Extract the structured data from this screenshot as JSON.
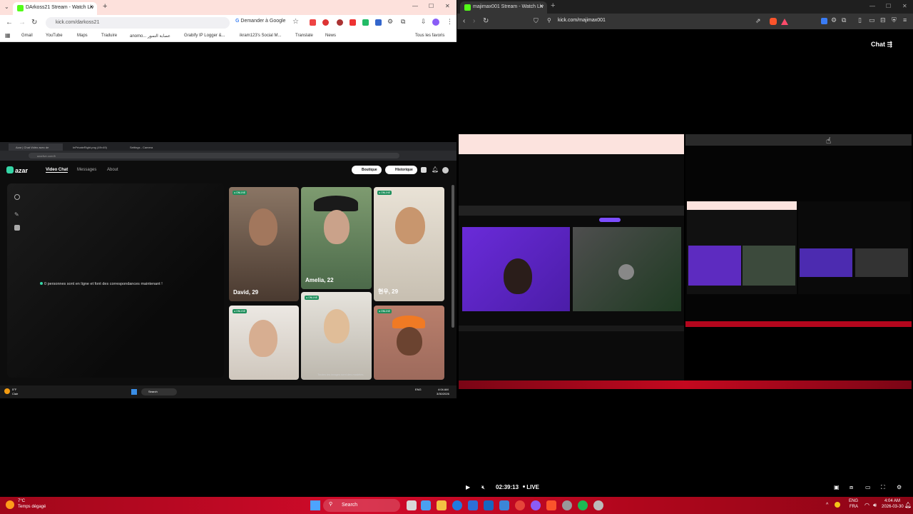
{
  "left_browser": {
    "tab_title": "DArkoss21 Stream - Watch Liv",
    "url": "kick.com/darkoss21",
    "ask_google": "Demander à Google",
    "bookmarks": [
      "Gmail",
      "YouTube",
      "Maps",
      "Traduire",
      "anomo... عصابة النمور",
      "Grabify IP Logger &...",
      "ikram123's Social M...",
      "Translate",
      "News"
    ],
    "all_favorites": "Tous les favoris"
  },
  "azar_window": {
    "tabs": [
      "Azar | Chat Vidéo avec de",
      "InPrivateRight.png (49×49)",
      "Settings - Camera"
    ],
    "url": "azarlive.com/fr",
    "logo": "azar",
    "nav": [
      "Video Chat",
      "Messages",
      "About"
    ],
    "boutique": "Boutique",
    "historique": "Historique",
    "online_message": "0 personnes sont en ligne et font des correspondances maintenant !",
    "cards": [
      {
        "badge": "● ONLINE",
        "label": "David, 29"
      },
      {
        "badge": "",
        "label": "Amelia, 22"
      },
      {
        "badge": "● ONLINE",
        "label": "현우, 29"
      },
      {
        "badge": "● ONLINE",
        "label": ""
      },
      {
        "badge": "● ONLINE",
        "label": ""
      },
      {
        "badge": "● ONLINE",
        "label": ""
      }
    ],
    "caption": "Toutes les images sont des modèles",
    "taskbar_weather": "5°F",
    "taskbar_weather_sub": "Clair",
    "taskbar_search": "Search",
    "taskbar_lang": "ENG",
    "taskbar_clock": "4:04 AM",
    "taskbar_date": "3/30/2026"
  },
  "right_browser": {
    "tab_title": "majimax001 Stream - Watch Liv",
    "url": "kick.com/majimax001",
    "chat_label": "Chat",
    "time": "02:39:13",
    "live_label": "LIVE",
    "progress": 1.0
  },
  "taskbar": {
    "weather_temp": "7°C",
    "weather_desc": "Temps dégagé",
    "search": "Search",
    "lang_top": "ENG",
    "lang_bottom": "FRA",
    "time": "4:04 AM",
    "date": "2026-03-30"
  },
  "colors": {
    "kick_green": "#53fc18",
    "azar_teal": "#35d6a6",
    "taskbar_red": "#c4081f"
  }
}
